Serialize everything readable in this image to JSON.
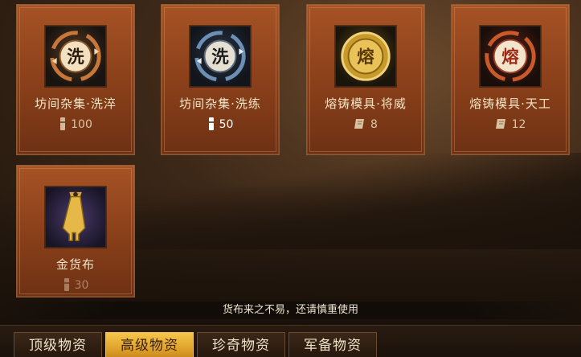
{
  "items": [
    {
      "name": "坊间杂集·洗淬",
      "icon": "wash-token-bronze-icon",
      "glyph": "洗",
      "cost": "100",
      "cost_icon": "tally-stick-icon",
      "cost_color": "#d4b89a"
    },
    {
      "name": "坊间杂集·洗练",
      "icon": "wash-token-silver-icon",
      "glyph": "洗",
      "cost": "50",
      "cost_icon": "tally-stick-icon",
      "cost_color": "#ffffff"
    },
    {
      "name": "熔铸模具·将威",
      "icon": "forge-mold-gold-icon",
      "glyph": "熔",
      "cost": "8",
      "cost_icon": "scroll-icon",
      "cost_color": "#d4b89a"
    },
    {
      "name": "熔铸模具·天工",
      "icon": "forge-mold-red-icon",
      "glyph": "熔",
      "cost": "12",
      "cost_icon": "scroll-icon",
      "cost_color": "#d4b89a"
    },
    {
      "name": "金货布",
      "icon": "gold-spade-coin-icon",
      "cost": "30",
      "cost_icon": "tally-stick-icon",
      "cost_color": "#d4b89a"
    }
  ],
  "notice": "货布来之不易，还请慎重使用",
  "tabs": [
    {
      "label": "顶级物资",
      "active": false
    },
    {
      "label": "高级物资",
      "active": true
    },
    {
      "label": "珍奇物资",
      "active": false
    },
    {
      "label": "军备物资",
      "active": false
    }
  ],
  "colors": {
    "card": "#9a4a20",
    "active_tab": "#f2b63c",
    "text_light": "#f4e4c6"
  }
}
